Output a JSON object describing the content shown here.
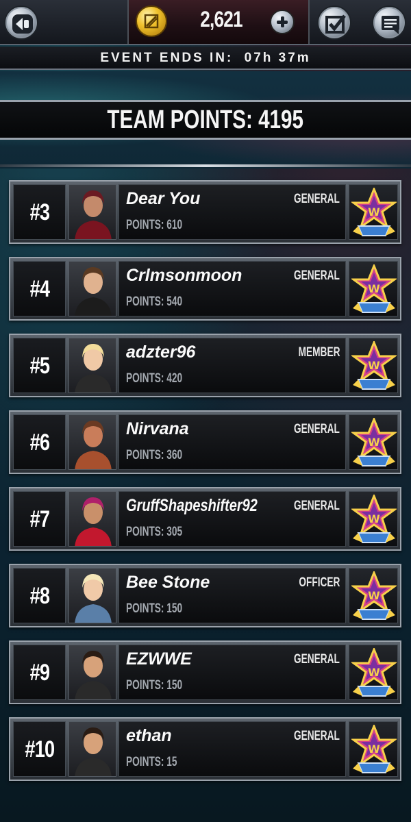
{
  "header": {
    "back_icon": "back-arrow-icon",
    "currency_icon": "coin-icon",
    "coins": "2,621",
    "add_icon": "plus-icon",
    "tasks_icon": "checkbox-icon",
    "news_icon": "message-icon"
  },
  "event": {
    "label": "EVENT ENDS IN:",
    "time": "07h 37m"
  },
  "team": {
    "points_text": "TEAM POINTS: 4195"
  },
  "members": [
    {
      "rank": "#3",
      "name": "Dear You",
      "role": "GENERAL",
      "points": "POINTS: 610"
    },
    {
      "rank": "#4",
      "name": "Crlmsonmoon",
      "role": "GENERAL",
      "points": "POINTS: 540"
    },
    {
      "rank": "#5",
      "name": "adzter96",
      "role": "MEMBER",
      "points": "POINTS: 420"
    },
    {
      "rank": "#6",
      "name": "Nirvana",
      "role": "GENERAL",
      "points": "POINTS: 360"
    },
    {
      "rank": "#7",
      "name": "GruffShapeshifter92",
      "role": "GENERAL",
      "points": "POINTS: 305"
    },
    {
      "rank": "#8",
      "name": "Bee Stone",
      "role": "OFFICER",
      "points": "POINTS: 150"
    },
    {
      "rank": "#9",
      "name": "EZWWE",
      "role": "GENERAL",
      "points": "POINTS: 150"
    },
    {
      "rank": "#10",
      "name": "ethan",
      "role": "GENERAL",
      "points": "POINTS: 15"
    }
  ],
  "colors": {
    "gold": "#f0c12c",
    "panel_dark": "#0b0c0e",
    "badge_pink": "#d4408a",
    "badge_blue": "#3b7fd1"
  }
}
